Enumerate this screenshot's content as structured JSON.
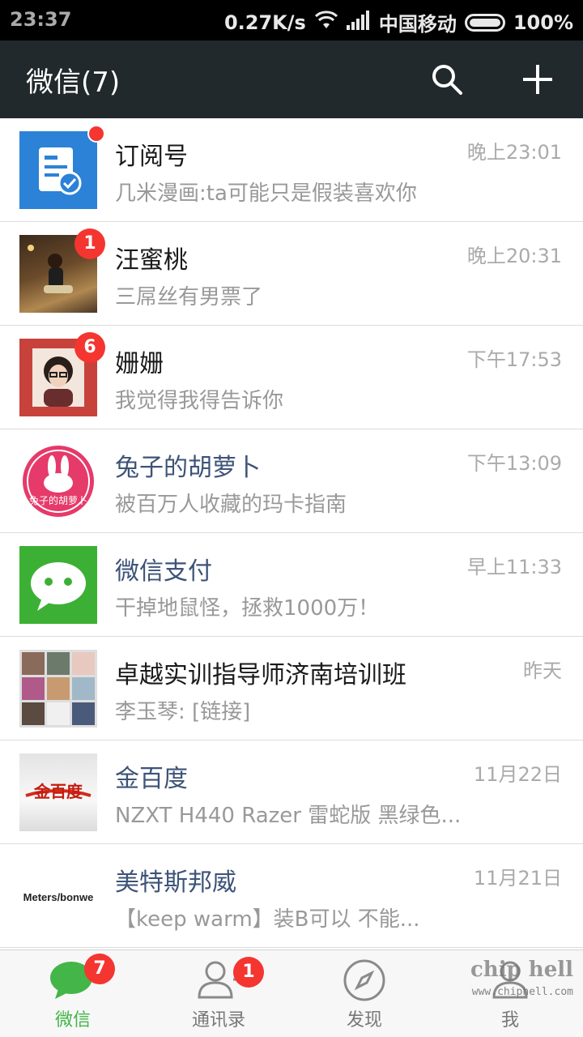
{
  "status_bar": {
    "time": "23:37",
    "speed": "0.27K/s",
    "carrier": "中国移动",
    "battery": "100%"
  },
  "header": {
    "title": "微信(7)"
  },
  "chats": [
    {
      "name": "订阅号",
      "preview": "几米漫画:ta可能只是假装喜欢你",
      "time": "晚上23:01",
      "badge": "",
      "dot": true,
      "service": false,
      "avatar": "subscription-icon"
    },
    {
      "name": "汪蜜桃",
      "preview": "三屌丝有男票了",
      "time": "晚上20:31",
      "badge": "1",
      "dot": false,
      "service": false,
      "avatar": "photo-avatar"
    },
    {
      "name": "姗姗",
      "preview": "我觉得我得告诉你",
      "time": "下午17:53",
      "badge": "6",
      "dot": false,
      "service": false,
      "avatar": "photo-avatar"
    },
    {
      "name": "兔子的胡萝卜",
      "preview": "被百万人收藏的玛卡指南",
      "time": "下午13:09",
      "badge": "",
      "dot": false,
      "service": true,
      "avatar": "rabbit-logo"
    },
    {
      "name": "微信支付",
      "preview": "干掉地鼠怪，拯救1000万！",
      "time": "早上11:33",
      "badge": "",
      "dot": false,
      "service": true,
      "avatar": "wechat-logo"
    },
    {
      "name": "卓越实训指导师济南培训班",
      "preview": "李玉琴: [链接]",
      "time": "昨天",
      "badge": "",
      "dot": false,
      "service": false,
      "avatar": "group-avatar"
    },
    {
      "name": "金百度",
      "preview": "NZXT H440 Razer 雷蛇版 黑绿色...",
      "time": "11月22日",
      "badge": "",
      "dot": false,
      "service": true,
      "avatar": "jinbaidu-logo"
    },
    {
      "name": "美特斯邦威",
      "preview": "【keep warm】装B可以 不能...",
      "time": "11月21日",
      "badge": "",
      "dot": false,
      "service": true,
      "avatar": "metersbonwe-logo"
    }
  ],
  "avatar_text": {
    "rabbit": "兔子的胡萝卜",
    "jinbaidu": "金百度",
    "metersbonwe": "Meters/bonwe"
  },
  "tabs": [
    {
      "label": "微信",
      "badge": "7",
      "active": true
    },
    {
      "label": "通讯录",
      "badge": "1",
      "active": false
    },
    {
      "label": "发现",
      "badge": "",
      "active": false
    },
    {
      "label": "我",
      "badge": "",
      "active": false
    }
  ],
  "watermark": {
    "brand": "chip hell",
    "url": "www.chiphell.com"
  },
  "colors": {
    "header_bg": "#22292c",
    "accent_green": "#44b549",
    "badge_red": "#f43530",
    "service_name": "#3d5378"
  }
}
